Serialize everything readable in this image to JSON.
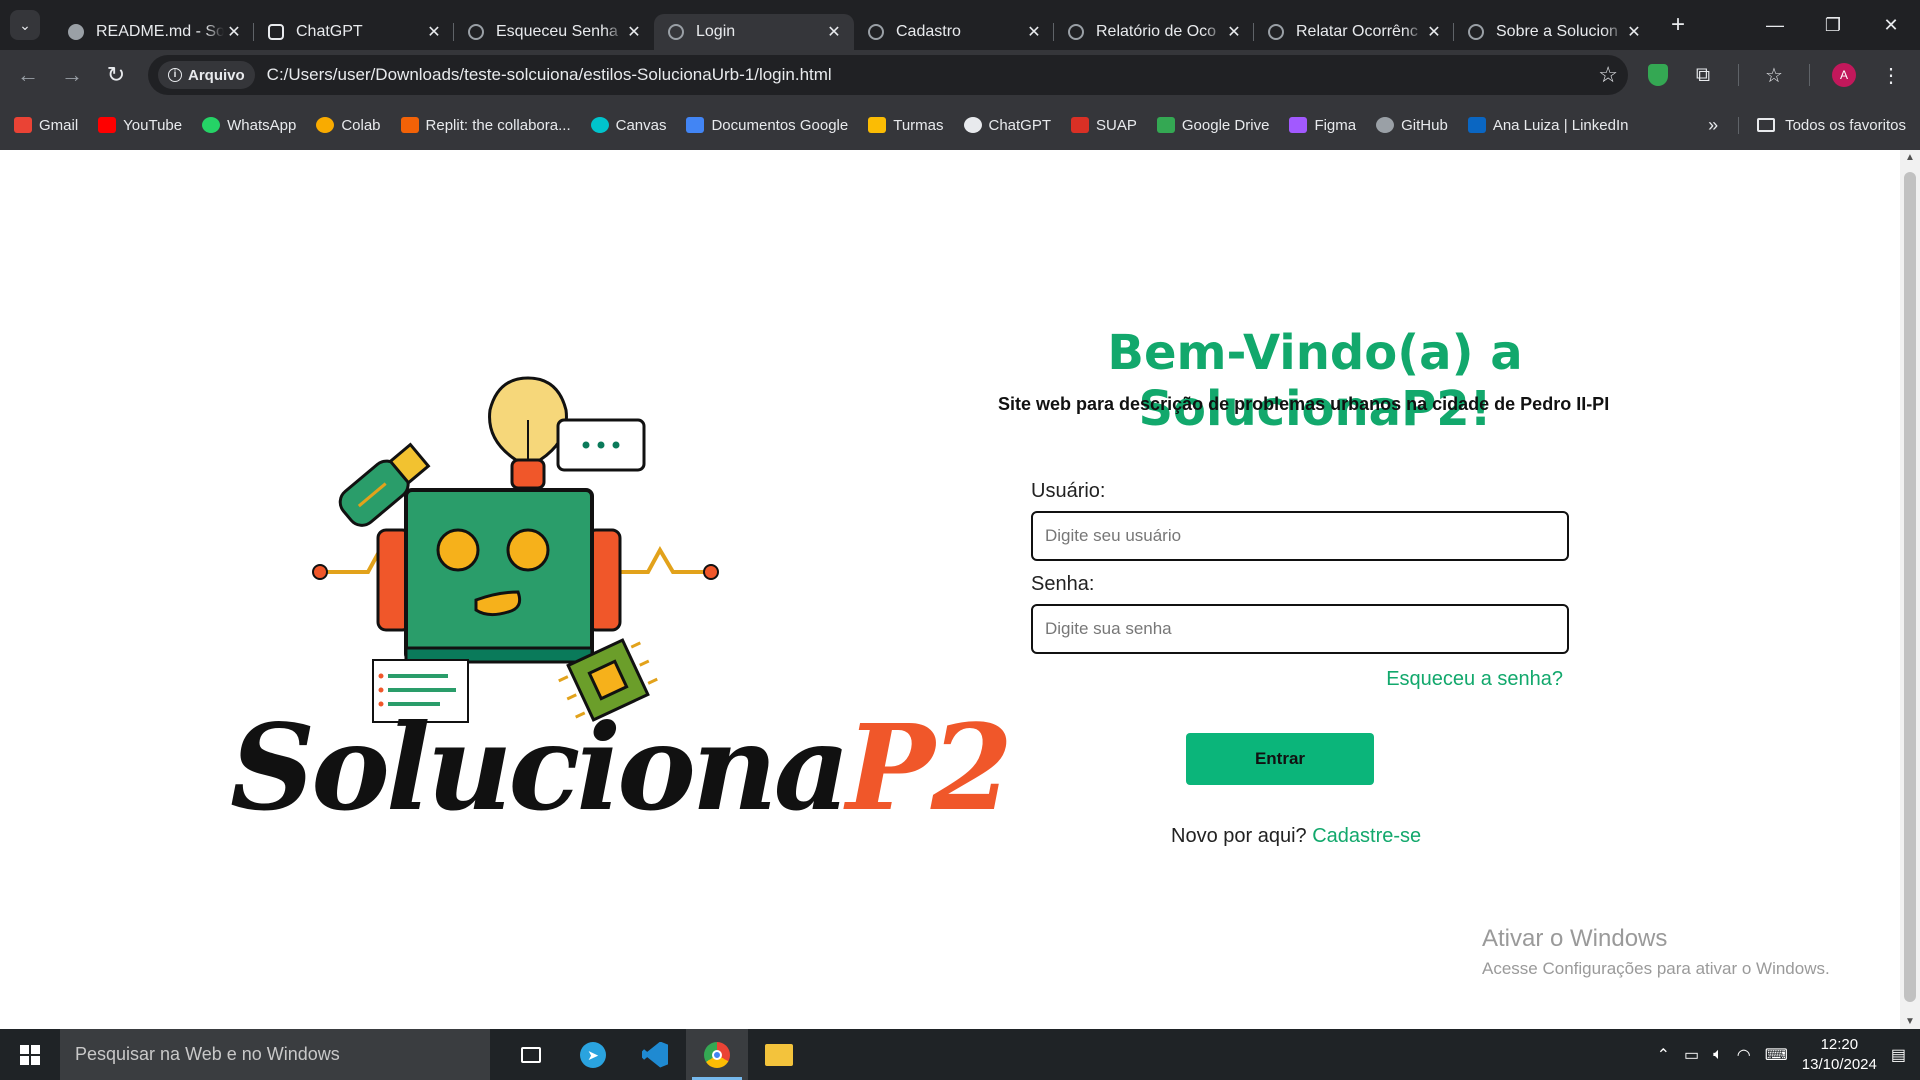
{
  "browser": {
    "tabs": [
      {
        "title": "README.md - So",
        "icon": "github-icon",
        "active": false
      },
      {
        "title": "ChatGPT",
        "icon": "chatgpt-icon",
        "active": false
      },
      {
        "title": "Esqueceu Senha",
        "icon": "globe-icon",
        "active": false
      },
      {
        "title": "Login",
        "icon": "globe-icon",
        "active": true
      },
      {
        "title": "Cadastro",
        "icon": "globe-icon",
        "active": false
      },
      {
        "title": "Relatório de Oco",
        "icon": "globe-icon",
        "active": false
      },
      {
        "title": "Relatar Ocorrênc",
        "icon": "globe-icon",
        "active": false
      },
      {
        "title": "Sobre a Solucion",
        "icon": "globe-icon",
        "active": false
      }
    ],
    "omnibox": {
      "chip_label": "Arquivo",
      "url": "C:/Users/user/Downloads/teste-solcuiona/estilos-SolucionaUrb-1/login.html"
    },
    "profile_initial": "A",
    "bookmarks": [
      {
        "label": "Gmail",
        "color": "#ea4335"
      },
      {
        "label": "YouTube",
        "color": "#ff0000"
      },
      {
        "label": "WhatsApp",
        "color": "#25d366"
      },
      {
        "label": "Colab",
        "color": "#f9ab00"
      },
      {
        "label": "Replit: the collabora...",
        "color": "#f26207"
      },
      {
        "label": "Canvas",
        "color": "#00c4cc"
      },
      {
        "label": "Documentos Google",
        "color": "#4285f4"
      },
      {
        "label": "Turmas",
        "color": "#fbbc04"
      },
      {
        "label": "ChatGPT",
        "color": "#e8eaed"
      },
      {
        "label": "SUAP",
        "color": "#d93025"
      },
      {
        "label": "Google Drive",
        "color": "#34a853"
      },
      {
        "label": "Figma",
        "color": "#a259ff"
      },
      {
        "label": "GitHub",
        "color": "#9aa0a6"
      },
      {
        "label": "Ana Luiza | LinkedIn",
        "color": "#0a66c2"
      }
    ],
    "bookmarks_more": "»",
    "all_bookmarks_label": "Todos os favoritos"
  },
  "page": {
    "welcome_title": "Bem-Vindo(a) a SolucionaP2!",
    "subtitle": "Site web para descrição de problemas urbanos na cidade de Pedro II-PI",
    "brand_main": "Soluciona",
    "brand_accent": "P2",
    "username_label": "Usuário:",
    "username_placeholder": "Digite seu usuário",
    "password_label": "Senha:",
    "password_placeholder": "Digite sua senha",
    "forgot_link": "Esqueceu a senha?",
    "submit_label": "Entrar",
    "signup_prompt": "Novo por aqui?",
    "signup_link": "Cadastre-se",
    "accent_color": "#12a86c"
  },
  "windows": {
    "activation_title": "Ativar o Windows",
    "activation_subtitle": "Acesse Configurações para ativar o Windows.",
    "search_placeholder": "Pesquisar na Web e no Windows",
    "time": "12:20",
    "date": "13/10/2024"
  }
}
